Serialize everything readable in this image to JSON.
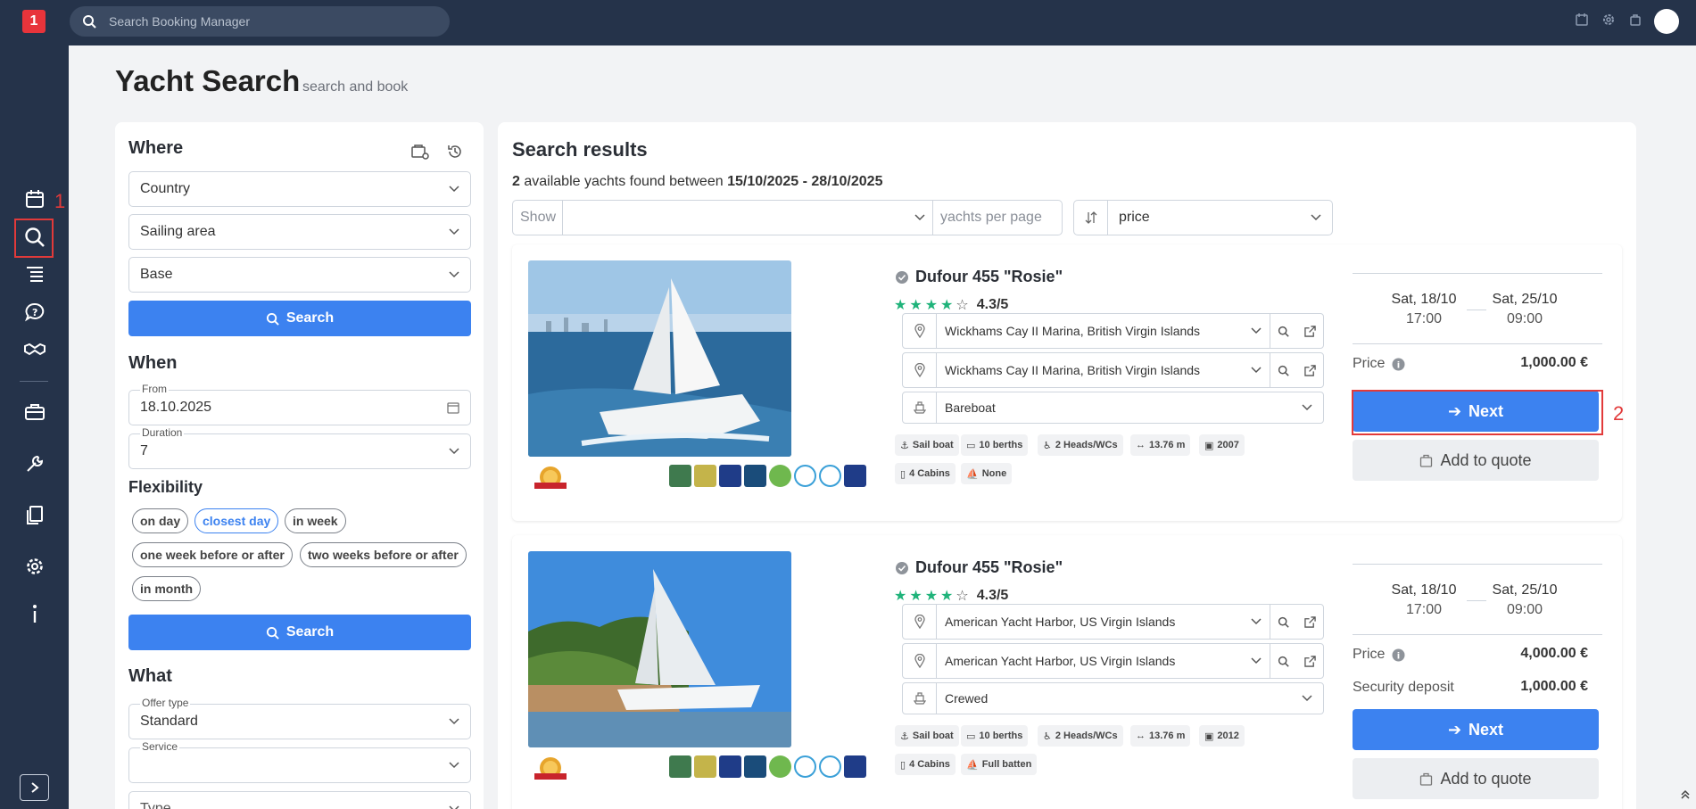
{
  "topbar": {
    "search_placeholder": "Search Booking Manager",
    "logo_glyph": "1"
  },
  "annotations": {
    "label1": "1",
    "label2": "2"
  },
  "header": {
    "title": "Yacht Search",
    "subtitle": "search and book"
  },
  "left": {
    "where_title": "Where",
    "country": "Country",
    "sailing_area": "Sailing area",
    "base": "Base",
    "search_label": "Search",
    "when_title": "When",
    "from_label": "From",
    "from_value": "18.10.2025",
    "duration_label": "Duration",
    "duration_value": "7",
    "flex_title": "Flexibility",
    "chips": [
      "on day",
      "closest day",
      "in week",
      "one week before or after",
      "two weeks before or after",
      "in month"
    ],
    "search2_label": "Search",
    "what_title": "What",
    "offer_label": "Offer type",
    "offer_value": "Standard",
    "service_label": "Service",
    "service_value": "",
    "type_label": "Type"
  },
  "results": {
    "title": "Search results",
    "count": "2",
    "found_text": "available yachts found between",
    "date_from": "15/10/2025",
    "date_sep": "-",
    "date_to": "28/10/2025",
    "show_label": "Show",
    "per_page_label": "yachts per page",
    "sort_value": "price",
    "cards": [
      {
        "name": "Dufour 455 \"Rosie\"",
        "rating": "4.3/5",
        "loc1": "Wickhams Cay II Marina, British Virgin Islands",
        "loc2": "Wickhams Cay II Marina, British Virgin Islands",
        "charter_type": "Bareboat",
        "features": [
          "Sail boat",
          "10 berths",
          "2 Heads/WCs",
          "13.76 m",
          "2007",
          "4 Cabins",
          "None"
        ],
        "start_day": "Sat, 18/10",
        "start_time": "17:00",
        "end_day": "Sat, 25/10",
        "end_time": "09:00",
        "price_label": "Price",
        "price": "1,000.00 €",
        "next_label": "Next",
        "quote_label": "Add to quote"
      },
      {
        "name": "Dufour 455 \"Rosie\"",
        "rating": "4.3/5",
        "loc1": "American Yacht Harbor, US Virgin Islands",
        "loc2": "American Yacht Harbor, US Virgin Islands",
        "charter_type": "Crewed",
        "features": [
          "Sail boat",
          "10 berths",
          "2 Heads/WCs",
          "13.76 m",
          "2012",
          "4 Cabins",
          "Full batten"
        ],
        "start_day": "Sat, 18/10",
        "start_time": "17:00",
        "end_day": "Sat, 25/10",
        "end_time": "09:00",
        "price_label": "Price",
        "price": "4,000.00 €",
        "deposit_label": "Security deposit",
        "deposit": "1,000.00 €",
        "next_label": "Next",
        "quote_label": "Add to quote"
      }
    ]
  },
  "colors": {
    "primary": "#3c82f0",
    "nav": "#25334a",
    "annotation": "#e23a3a",
    "star": "#1fb37a"
  }
}
